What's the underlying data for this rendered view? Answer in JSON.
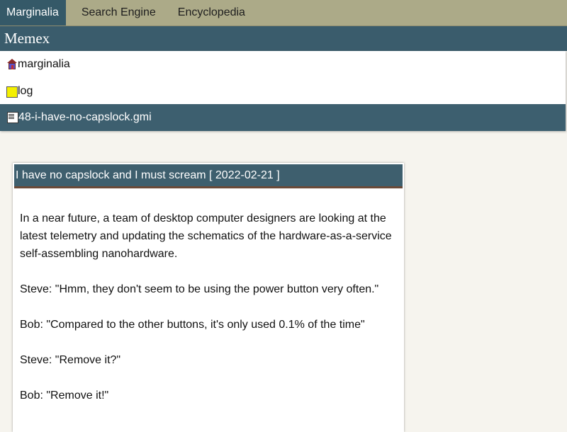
{
  "nav": {
    "items": [
      {
        "label": "Marginalia",
        "active": true
      },
      {
        "label": "Search Engine",
        "active": false
      },
      {
        "label": "Encyclopedia",
        "active": false
      }
    ]
  },
  "memex": {
    "title": "Memex",
    "items": [
      {
        "icon": "home-icon",
        "label": "marginalia"
      },
      {
        "icon": "folder-icon",
        "label": "log"
      },
      {
        "icon": "file-icon",
        "label": "48-i-have-no-capslock.gmi",
        "current": true
      }
    ]
  },
  "article": {
    "title": "I have no capslock and I must scream [ 2022-02-21 ]",
    "paragraphs": [
      "In a near future, a team of desktop computer designers are looking at the latest telemetry and updating the schematics of the hardware-as-a-service self-assembling nanohardware.",
      "Steve: \"Hmm, they don't seem to be using the power button very often.\"",
      "Bob: \"Compared to the other buttons, it's only used 0.1% of the time\"",
      "Steve: \"Remove it?\"",
      "Bob: \"Remove it!\""
    ]
  },
  "colors": {
    "nav_bg": "#acaa88",
    "accent": "#3a5c6c",
    "page_bg": "#f6f4ee"
  }
}
